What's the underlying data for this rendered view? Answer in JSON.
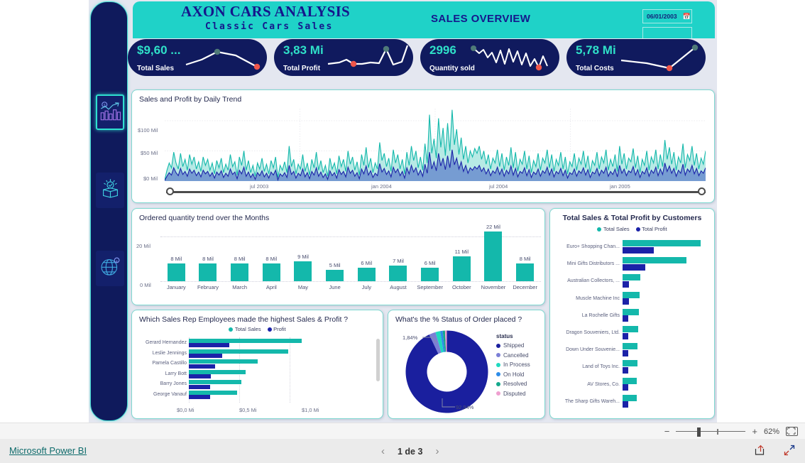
{
  "header": {
    "title_main": "AXON CARS ANALYSIS",
    "title_sub": "Classic Cars Sales",
    "title_overview": "SALES OVERVIEW",
    "date_slicer_value": "06/01/2003",
    "date_slicer_icon": "calendar-icon"
  },
  "sidebar": {
    "items": [
      {
        "name": "sales-analysis-icon",
        "label": "Sales Analysis",
        "active": true
      },
      {
        "name": "product-box-icon",
        "label": "Products",
        "active": false
      },
      {
        "name": "globe-location-icon",
        "label": "Geography",
        "active": false
      }
    ]
  },
  "kpis": [
    {
      "value": "$9,60 ...",
      "label": "Total Sales"
    },
    {
      "value": "3,83 Mi",
      "label": "Total Profit"
    },
    {
      "value": "2996",
      "label": "Quantity sold"
    },
    {
      "value": "5,78 Mi",
      "label": "Total Costs"
    }
  ],
  "colors": {
    "teal": "#14b8ab",
    "teal_bright": "#2fe0c8",
    "navy": "#1b22a8",
    "navy_dark": "#101a5e",
    "banner": "#1fd2c8",
    "area_teal": "#9fe3dc",
    "area_navy": "#6f93cf",
    "accent_red": "#f0564a",
    "accent_grey_green": "#4f7a78"
  },
  "chart_data": [
    {
      "type": "area",
      "title": "Sales and Profit by Daily Trend",
      "xlabel": "",
      "ylabel": "",
      "ylim": [
        0,
        120
      ],
      "ytick_labels": [
        "$0 Mil",
        "$50 Mil",
        "$100 Mil"
      ],
      "ytick_values": [
        0,
        50,
        100
      ],
      "xtick_labels": [
        "jul 2003",
        "jan 2004",
        "jul 2004",
        "jan 2005"
      ],
      "grid": true,
      "legend": "none",
      "series": [
        {
          "name": "Sales",
          "color": "#14b8ab",
          "values": [
            2,
            18,
            30,
            22,
            48,
            30,
            20,
            46,
            24,
            36,
            18,
            44,
            28,
            40,
            20,
            32,
            16,
            40,
            26,
            36,
            18,
            30,
            12,
            34,
            22,
            38,
            14,
            28,
            18,
            44,
            24,
            32,
            10,
            40,
            26,
            50,
            18,
            34,
            14,
            26,
            8,
            30,
            20,
            38,
            16,
            28,
            12,
            34,
            22,
            40,
            6,
            26,
            18,
            32,
            14,
            58,
            24,
            36,
            12,
            28,
            20,
            44,
            16,
            30,
            10,
            36,
            22,
            48,
            18,
            34,
            14,
            26,
            8,
            38,
            20,
            30,
            12,
            42,
            24,
            36,
            16,
            50,
            28,
            40,
            18,
            32,
            10,
            44,
            26,
            56,
            22,
            38,
            14,
            30,
            20,
            64,
            34,
            46,
            24,
            38,
            16,
            52,
            30,
            44,
            20,
            36,
            12,
            48,
            26,
            58,
            34,
            50,
            22,
            40,
            18,
            62,
            30,
            110,
            46,
            70,
            38,
            104,
            56,
            88,
            42,
            96,
            50,
            118,
            60,
            86,
            44,
            72,
            36,
            58,
            30,
            50,
            40,
            54,
            46,
            58,
            36,
            50,
            28,
            44,
            20,
            38,
            30,
            52,
            24,
            46,
            18,
            40,
            26,
            56,
            22,
            48,
            16,
            36,
            28,
            50,
            20,
            42,
            14,
            34,
            24,
            46,
            18,
            38,
            30,
            52,
            22,
            44,
            16,
            36,
            26,
            48,
            20,
            40,
            12,
            32,
            24,
            46,
            18,
            38,
            28,
            50,
            22,
            42,
            14,
            34,
            26,
            48,
            20,
            40,
            30,
            52,
            18,
            36,
            24,
            44,
            16,
            58,
            28,
            46,
            20,
            38,
            32,
            54,
            22,
            42,
            14,
            36,
            26,
            50,
            18,
            40,
            30,
            52,
            20,
            44,
            24,
            68,
            36,
            56,
            28,
            48,
            18,
            40,
            30,
            62,
            22,
            44,
            34,
            58,
            26,
            46,
            20,
            38,
            28,
            50
          ]
        },
        {
          "name": "Profit",
          "color": "#1b22a8",
          "values": [
            1,
            8,
            14,
            10,
            22,
            14,
            9,
            21,
            11,
            16,
            8,
            20,
            13,
            18,
            9,
            15,
            7,
            18,
            12,
            16,
            8,
            14,
            5,
            15,
            10,
            17,
            6,
            13,
            8,
            20,
            11,
            15,
            4,
            18,
            12,
            23,
            8,
            15,
            6,
            12,
            3,
            14,
            9,
            17,
            7,
            13,
            5,
            15,
            10,
            18,
            2,
            12,
            8,
            14,
            6,
            26,
            11,
            16,
            5,
            13,
            9,
            20,
            7,
            14,
            4,
            16,
            10,
            22,
            8,
            15,
            6,
            12,
            3,
            17,
            9,
            14,
            5,
            19,
            11,
            16,
            7,
            23,
            13,
            18,
            8,
            14,
            4,
            20,
            12,
            25,
            10,
            17,
            6,
            13,
            9,
            29,
            15,
            21,
            11,
            17,
            7,
            23,
            14,
            20,
            9,
            16,
            5,
            22,
            12,
            26,
            15,
            22,
            10,
            18,
            8,
            28,
            13,
            48,
            20,
            32,
            17,
            46,
            25,
            38,
            19,
            42,
            22,
            52,
            27,
            38,
            20,
            32,
            16,
            26,
            13,
            22,
            18,
            24,
            20,
            26,
            16,
            22,
            12,
            20,
            9,
            17,
            13,
            23,
            11,
            20,
            8,
            18,
            12,
            25,
            10,
            21,
            7,
            16,
            13,
            22,
            9,
            19,
            6,
            15,
            11,
            20,
            8,
            17,
            13,
            23,
            10,
            20,
            7,
            16,
            12,
            21,
            9,
            18,
            5,
            14,
            11,
            20,
            8,
            17,
            13,
            22,
            10,
            19,
            6,
            15,
            12,
            21,
            9,
            18,
            13,
            23,
            8,
            16,
            11,
            20,
            7,
            26,
            13,
            20,
            9,
            17,
            14,
            24,
            10,
            19,
            6,
            16,
            12,
            22,
            8,
            18,
            13,
            23,
            9,
            20,
            11,
            30,
            16,
            25,
            13,
            21,
            8,
            18,
            13,
            28,
            10,
            20,
            15,
            26,
            12,
            21,
            9,
            17,
            13,
            22
          ]
        }
      ],
      "slider": {
        "left_handle": 0,
        "right_handle": 100
      }
    },
    {
      "type": "bar",
      "title": "Ordered quantity trend over the Months",
      "categories": [
        "January",
        "February",
        "March",
        "April",
        "May",
        "June",
        "July",
        "August",
        "September",
        "October",
        "November",
        "December"
      ],
      "values": [
        8,
        8,
        8,
        8,
        9,
        5,
        6,
        7,
        6,
        11,
        22,
        8
      ],
      "data_labels": [
        "8 Mil",
        "8 Mil",
        "8 Mil",
        "8 Mil",
        "9 Mil",
        "5 Mil",
        "6 Mil",
        "7 Mil",
        "6 Mil",
        "11 Mil",
        "22 Mil",
        "8 Mil"
      ],
      "ytick_labels": [
        "0 Mil",
        "20 Mil"
      ],
      "ytick_values": [
        0,
        20
      ],
      "ylim": [
        0,
        24
      ],
      "xlabel": "",
      "ylabel": "",
      "color": "#14b8ab",
      "grid": true
    },
    {
      "type": "bar",
      "orientation": "horizontal",
      "title": "Total Sales & Total Profit by Customers",
      "legend": [
        "Total Sales",
        "Total Profit"
      ],
      "legend_position": "top",
      "categories": [
        "Euro+ Shopping Chan...",
        "Mini Gifts Distributors ...",
        "Australian Collectors, ...",
        "Muscle Machine Inc",
        "La Rochelle Gifts",
        "Dragon Souveniers, Ltd.",
        "Down Under Souvenie...",
        "Land of Toys Inc.",
        "AV Stores, Co.",
        "The Sharp Gifts Wareh..."
      ],
      "series": [
        {
          "name": "Total Sales",
          "color": "#14b8ab",
          "values": [
            100,
            82,
            23,
            22,
            21,
            20,
            19,
            19,
            18,
            18
          ]
        },
        {
          "name": "Total Profit",
          "color": "#1b22a8",
          "values": [
            40,
            29,
            8,
            8,
            7,
            7,
            7,
            7,
            7,
            7
          ]
        }
      ]
    },
    {
      "type": "bar",
      "orientation": "horizontal",
      "title": "Which Sales Rep Employees made the highest Sales & Profit ?",
      "legend": [
        "Total Sales",
        "Profit"
      ],
      "legend_position": "top",
      "categories": [
        "Gerard Hernandez",
        "Leslie Jennings",
        "Pamela Castillo",
        "Larry Bott",
        "Barry Jones",
        "George Vanauf"
      ],
      "xtick_labels": [
        "$0,0 Mi",
        "$0,5 Mi",
        "$1,0 Mi"
      ],
      "xtick_values": [
        0,
        0.5,
        1.0
      ],
      "xlim": [
        0,
        1.25
      ],
      "series": [
        {
          "name": "Total Sales",
          "color": "#14b8ab",
          "values": [
            1.12,
            0.98,
            0.68,
            0.56,
            0.52,
            0.48
          ]
        },
        {
          "name": "Profit",
          "color": "#1b22a8",
          "values": [
            0.4,
            0.33,
            0.26,
            0.22,
            0.21,
            0.21
          ]
        }
      ],
      "scrollbar": true
    },
    {
      "type": "pie",
      "subtype": "donut",
      "title": "What's the % Status of Order placed ?",
      "legend_title": "status",
      "labels": [
        "Shipped",
        "Cancelled",
        "In Process",
        "On Hold",
        "Resolved",
        "Disputed"
      ],
      "values": [
        92.94,
        2.6,
        1.84,
        1.0,
        0.9,
        0.72
      ],
      "colors": [
        "#1a1f9e",
        "#7b7fd6",
        "#1fd9c0",
        "#2d8ce8",
        "#14a88c",
        "#ef9fd0"
      ],
      "callouts": [
        "92,94%",
        "1,84%"
      ],
      "legend_position": "right"
    }
  ],
  "statusbar": {
    "zoom_minus": "−",
    "zoom_plus": "+",
    "zoom_value": "62%",
    "fit_icon": "fit-to-page-icon"
  },
  "footer": {
    "brand_link": "Microsoft Power BI",
    "page_indicator": "1 de 3",
    "prev_icon": "chevron-left-icon",
    "next_icon": "chevron-right-icon",
    "share_icon": "share-icon",
    "fullscreen_icon": "fullscreen-icon"
  }
}
